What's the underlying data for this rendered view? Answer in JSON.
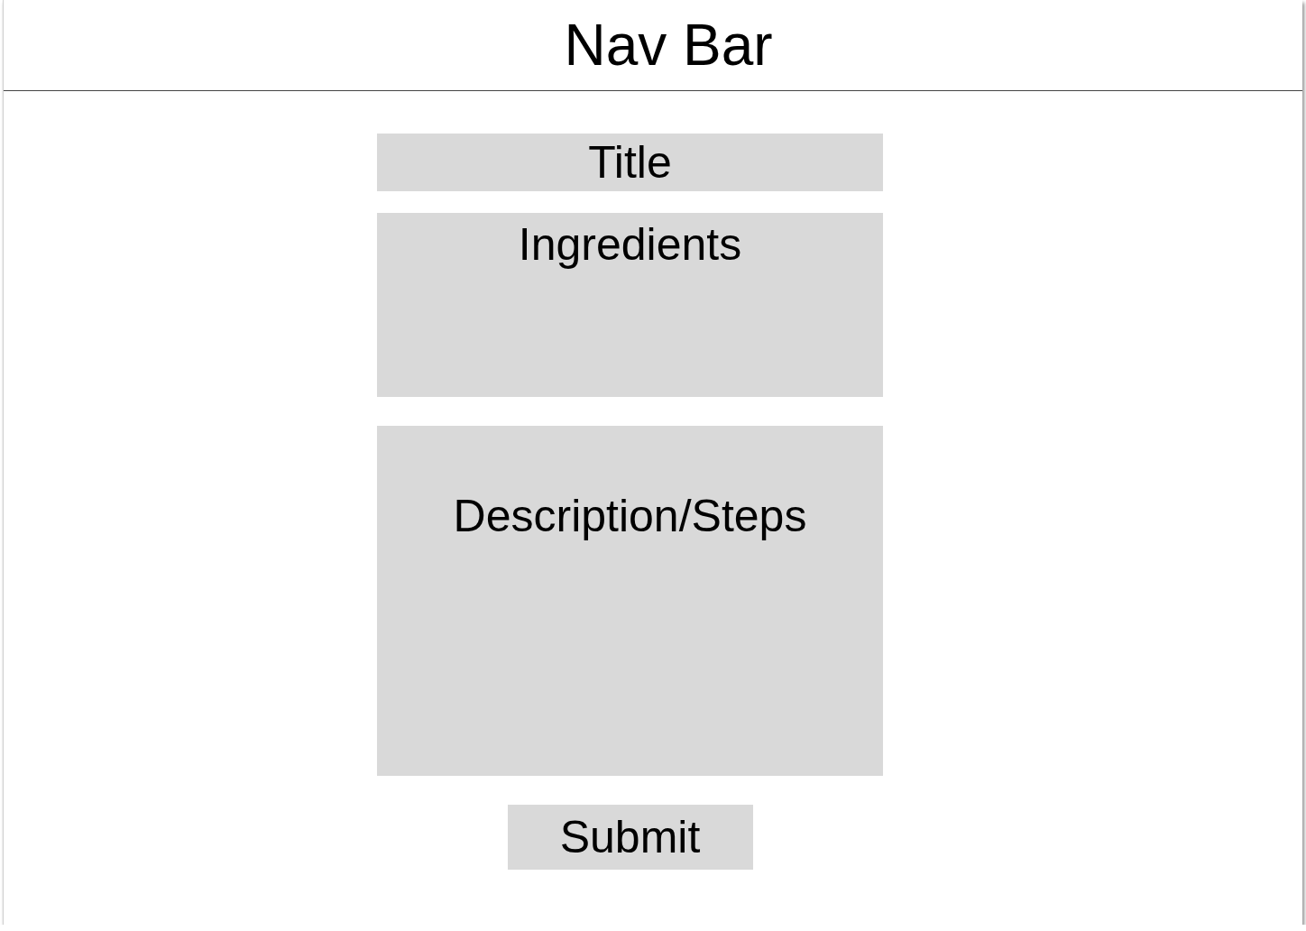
{
  "nav_bar": {
    "title": "Nav Bar"
  },
  "form": {
    "fields": [
      {
        "kind": "single_line",
        "placeholder": "Title"
      },
      {
        "kind": "multi_line",
        "placeholder": "Ingredients"
      },
      {
        "kind": "multi_line",
        "placeholder": "Description/Steps"
      }
    ],
    "submit_button": {
      "label": "Submit"
    }
  }
}
